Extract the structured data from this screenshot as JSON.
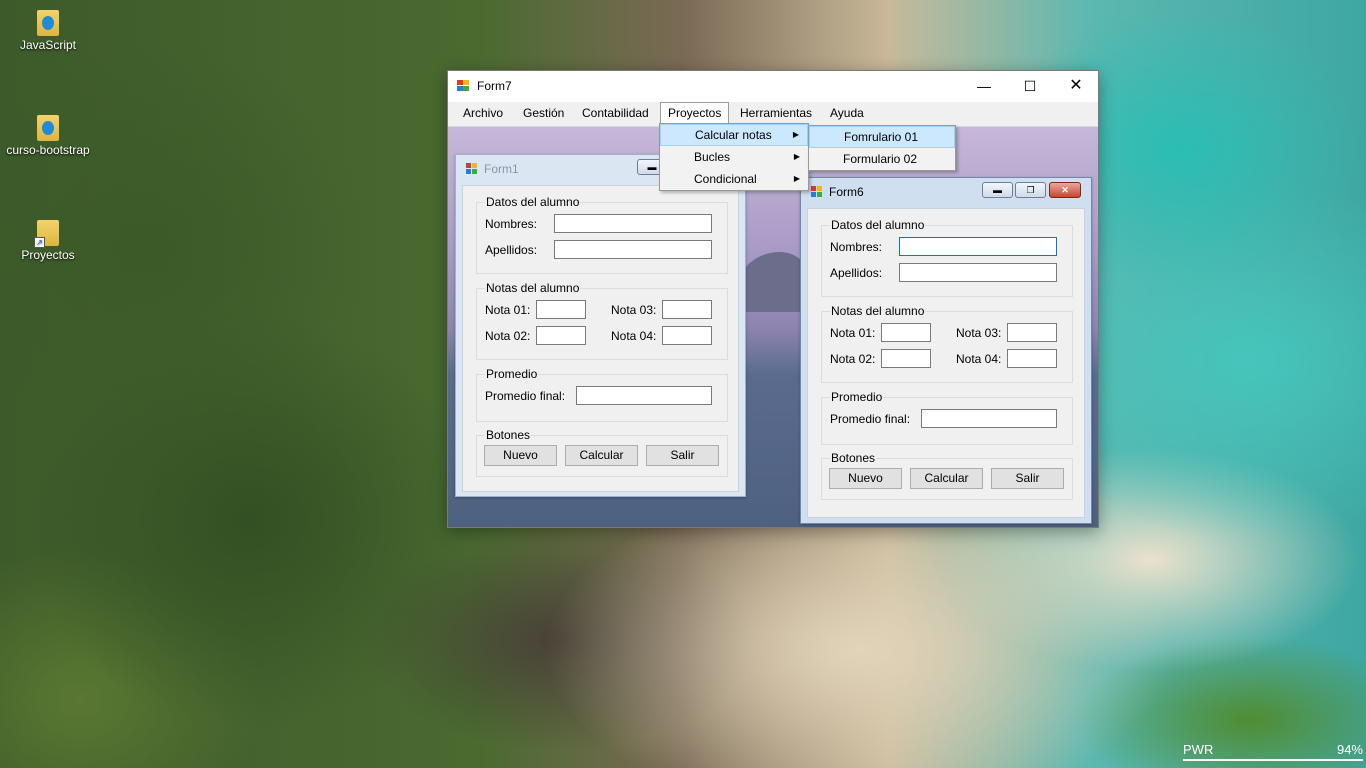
{
  "desktop": {
    "icons": [
      {
        "label": "JavaScript"
      },
      {
        "label": "curso-bootstrap"
      },
      {
        "label": "Proyectos"
      }
    ],
    "power": {
      "label": "PWR",
      "percent": "94%"
    }
  },
  "form7": {
    "title": "Form7",
    "menu": [
      "Archivo",
      "Gestión",
      "Contabilidad",
      "Proyectos",
      "Herramientas",
      "Ayuda"
    ],
    "proyectos_menu": [
      "Calcular notas",
      "Bucles",
      "Condicional"
    ],
    "calcular_submenu": [
      "Fomrulario 01",
      "Formulario 02"
    ]
  },
  "form1": {
    "title": "Form1",
    "group_datos": "Datos del alumno",
    "nombres_label": "Nombres:",
    "apellidos_label": "Apellidos:",
    "group_notas": "Notas del alumno",
    "nota01_label": "Nota 01:",
    "nota02_label": "Nota 02:",
    "nota03_label": "Nota 03:",
    "nota04_label": "Nota 04:",
    "group_promedio": "Promedio",
    "promedio_label": "Promedio final:",
    "group_botones": "Botones",
    "btn_nuevo": "Nuevo",
    "btn_calcular": "Calcular",
    "btn_salir": "Salir"
  },
  "form6": {
    "title": "Form6",
    "group_datos": "Datos del alumno",
    "nombres_label": "Nombres:",
    "apellidos_label": "Apellidos:",
    "group_notas": "Notas del alumno",
    "nota01_label": "Nota 01:",
    "nota02_label": "Nota 02:",
    "nota03_label": "Nota 03:",
    "nota04_label": "Nota 04:",
    "group_promedio": "Promedio",
    "promedio_label": "Promedio final:",
    "group_botones": "Botones",
    "btn_nuevo": "Nuevo",
    "btn_calcular": "Calcular",
    "btn_salir": "Salir"
  }
}
